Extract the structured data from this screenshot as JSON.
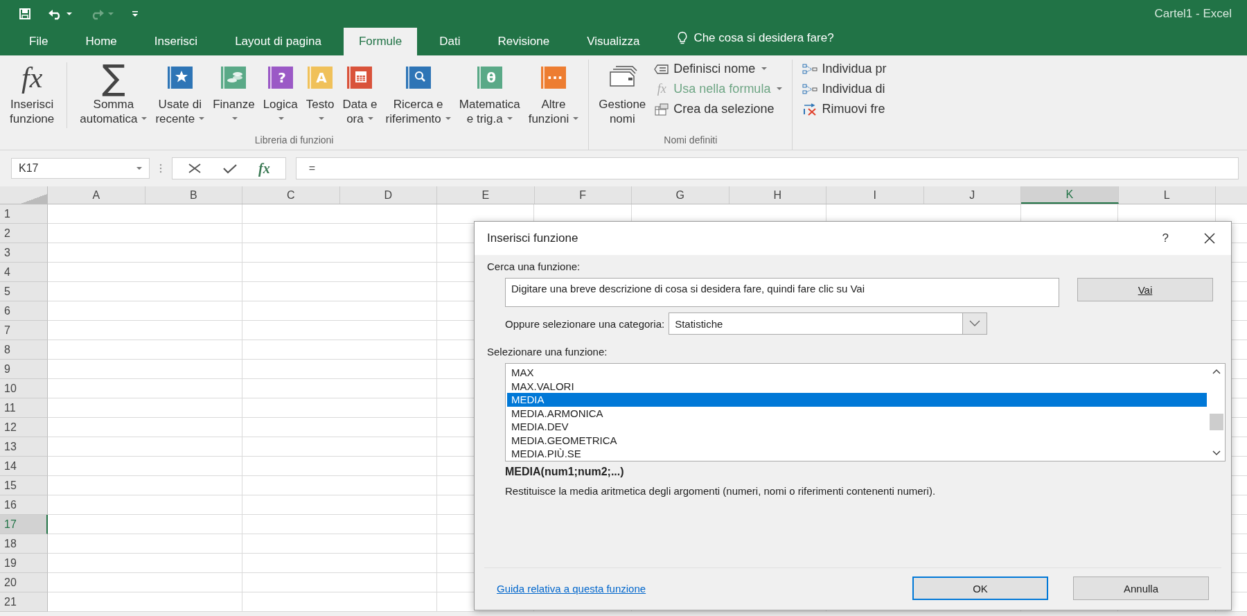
{
  "window": {
    "title": "Cartel1 - Excel"
  },
  "quick_access": [
    {
      "kind": "save",
      "caret": false,
      "disabled": false
    },
    {
      "kind": "undo",
      "caret": true,
      "disabled": false
    },
    {
      "kind": "redo",
      "caret": true,
      "disabled": true
    },
    {
      "kind": "customize",
      "caret": false,
      "disabled": false
    }
  ],
  "tabs": [
    {
      "label": "File",
      "selected": false
    },
    {
      "label": "Home",
      "selected": false
    },
    {
      "label": "Inserisci",
      "selected": false
    },
    {
      "label": "Layout di pagina",
      "selected": false
    },
    {
      "label": "Formule",
      "selected": true
    },
    {
      "label": "Dati",
      "selected": false
    },
    {
      "label": "Revisione",
      "selected": false
    },
    {
      "label": "Visualizza",
      "selected": false
    }
  ],
  "tell_me": {
    "placeholder": "Che cosa si desidera fare?"
  },
  "ribbon": [
    {
      "label": "Libreria di funzioni",
      "items": [
        {
          "kind": "fx",
          "glyph": "fx",
          "lines": [
            "Inserisci",
            "funzione"
          ],
          "dropdown": false
        },
        {
          "kind": "sigma",
          "glyph": "∑",
          "lines": [
            "Somma",
            "automatica"
          ],
          "dropdown": true
        },
        {
          "kind": "star",
          "color": "#2e75b6",
          "lines": [
            "Usate di",
            "recente"
          ],
          "dropdown": true
        },
        {
          "kind": "coins",
          "color": "#5aa987",
          "lines": [
            "Finanze"
          ],
          "dropdown": true
        },
        {
          "kind": "glyph",
          "glyph": "?",
          "color": "#9b59c6",
          "lines": [
            "Logica"
          ],
          "dropdown": true
        },
        {
          "kind": "glyph",
          "glyph": "A",
          "color": "#f0c15a",
          "lines": [
            "Testo"
          ],
          "dropdown": true
        },
        {
          "kind": "calendar",
          "color": "#d9533b",
          "lines": [
            "Data e",
            "ora"
          ],
          "dropdown": true
        },
        {
          "kind": "lookup",
          "color": "#2e75b6",
          "lines": [
            "Ricerca e",
            "riferimento"
          ],
          "dropdown": true
        },
        {
          "kind": "glyph",
          "glyph": "θ",
          "color": "#5aa987",
          "lines": [
            "Matematica",
            "e trig.a"
          ],
          "dropdown": true
        },
        {
          "kind": "glyph",
          "glyph": "···",
          "color": "#ed7d31",
          "lines": [
            "Altre",
            "funzioni"
          ],
          "dropdown": true
        }
      ]
    },
    {
      "label": "Nomi definiti",
      "items": [
        {
          "kind": "tags",
          "lines": [
            "Gestione",
            "nomi"
          ],
          "dropdown": false
        },
        {
          "kind": "stack",
          "entries": [
            {
              "kind": "label",
              "label": "Definisci nome",
              "dropdown": true,
              "disabled": false
            },
            {
              "kind": "formula",
              "glyph": "fx",
              "label": "Usa nella formula",
              "dropdown": true,
              "disabled": true
            },
            {
              "kind": "table",
              "label": "Crea da selezione",
              "dropdown": false,
              "disabled": false
            }
          ]
        }
      ]
    },
    {
      "items": [
        {
          "kind": "stack",
          "entries": [
            {
              "kind": "precedents",
              "label": "Individua pr",
              "dropdown": false,
              "disabled": false
            },
            {
              "kind": "dependents",
              "label": "Individua di",
              "dropdown": false,
              "disabled": false
            },
            {
              "kind": "remove",
              "label": "Rimuovi fre",
              "dropdown": false,
              "disabled": false
            }
          ]
        }
      ]
    }
  ],
  "formula_bar": {
    "name_box": "K17",
    "function_glyph": "fx",
    "formula": "="
  },
  "sheet": {
    "columns": [
      {
        "label": "A",
        "selected": false
      },
      {
        "label": "B",
        "selected": false
      },
      {
        "label": "C",
        "selected": false
      },
      {
        "label": "D",
        "selected": false
      },
      {
        "label": "E",
        "selected": false
      },
      {
        "label": "F",
        "selected": false
      },
      {
        "label": "G",
        "selected": false
      },
      {
        "label": "H",
        "selected": false
      },
      {
        "label": "I",
        "selected": false
      },
      {
        "label": "J",
        "selected": false
      },
      {
        "label": "K",
        "selected": true
      },
      {
        "label": "L",
        "selected": false
      }
    ],
    "rows": [
      {
        "label": "1",
        "selected": false
      },
      {
        "label": "2",
        "selected": false
      },
      {
        "label": "3",
        "selected": false
      },
      {
        "label": "4",
        "selected": false
      },
      {
        "label": "5",
        "selected": false
      },
      {
        "label": "6",
        "selected": false
      },
      {
        "label": "7",
        "selected": false
      },
      {
        "label": "8",
        "selected": false
      },
      {
        "label": "9",
        "selected": false
      },
      {
        "label": "10",
        "selected": false
      },
      {
        "label": "11",
        "selected": false
      },
      {
        "label": "12",
        "selected": false
      },
      {
        "label": "13",
        "selected": false
      },
      {
        "label": "14",
        "selected": false
      },
      {
        "label": "15",
        "selected": false
      },
      {
        "label": "16",
        "selected": false
      },
      {
        "label": "17",
        "selected": true
      },
      {
        "label": "18",
        "selected": false
      },
      {
        "label": "19",
        "selected": false
      },
      {
        "label": "20",
        "selected": false
      },
      {
        "label": "21",
        "selected": false
      }
    ]
  },
  "dialog": {
    "title": "Inserisci funzione",
    "help": "?",
    "search_label": "Cerca una funzione:",
    "search_value": "Digitare una breve descrizione di cosa si desidera fare, quindi fare clic su Vai",
    "go_button": "Vai",
    "category_label": "Oppure selezionare una categoria:",
    "category": "Statistiche",
    "list_label": "Selezionare una funzione:",
    "functions": [
      {
        "name": "MAX",
        "selected": false
      },
      {
        "name": "MAX.VALORI",
        "selected": false
      },
      {
        "name": "MEDIA",
        "selected": true
      },
      {
        "name": "MEDIA.ARMONICA",
        "selected": false
      },
      {
        "name": "MEDIA.DEV",
        "selected": false
      },
      {
        "name": "MEDIA.GEOMETRICA",
        "selected": false
      },
      {
        "name": "MEDIA.PIÙ.SE",
        "selected": false
      }
    ],
    "signature": "MEDIA(num1;num2;...)",
    "description": "Restituisce la media aritmetica degli argomenti (numeri, nomi o riferimenti contenenti numeri).",
    "help_link": "Guida relativa a questa funzione",
    "buttons": [
      {
        "label": "OK",
        "default": true
      },
      {
        "label": "Annulla",
        "default": false
      }
    ]
  }
}
